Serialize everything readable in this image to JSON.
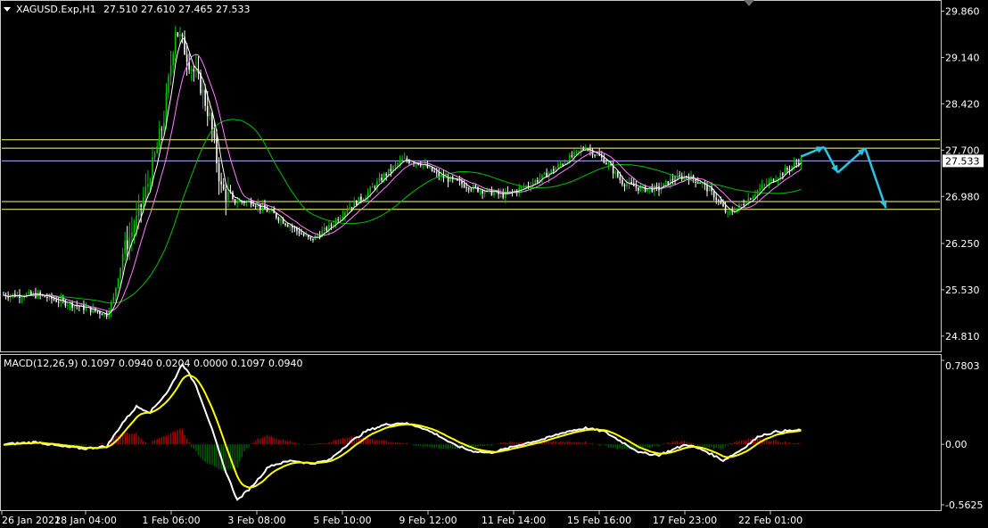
{
  "header": {
    "symbol_label": "XAGUSD.Exp,H1",
    "ohlc": "27.510 27.610 27.465 27.533"
  },
  "macd": {
    "label": "MACD(12,26,9) 0.1097 0.0940 0.0204 0.0000 0.1097 0.0940",
    "ylim": [
      -0.5625,
      0.7803
    ],
    "ticks": [
      "0.7803",
      "0.00",
      "-0.5625"
    ]
  },
  "price": {
    "current": "27.533",
    "ylim": [
      24.6,
      29.95
    ],
    "ticks": [
      "29.860",
      "29.140",
      "28.420",
      "27.700",
      "26.980",
      "26.250",
      "25.530",
      "24.810"
    ],
    "hlines_yellow": [
      27.86,
      27.73,
      26.9,
      26.78
    ],
    "hline_current": 27.533
  },
  "colors": {
    "background": "#000000",
    "border": "#c8c8c8",
    "up_candle": "#00c000",
    "down_candle": "#ffffff",
    "sma_fast": "#ffffff",
    "sma_mid": "#ff80ff",
    "sma_slow": "#00c000",
    "hline": "#ffff80",
    "current_line": "#b0b0ff",
    "macd_line": "#ffffff",
    "signal_line": "#ffff00",
    "hist_pos": "#b00000",
    "hist_neg": "#006000",
    "arrow": "#29c5e6"
  },
  "chart_data": {
    "type": "candlestick",
    "x_tick_labels": [
      "26 Jan 2021",
      "28 Jan 04:00",
      "1 Feb 06:00",
      "3 Feb 08:00",
      "5 Feb 10:00",
      "9 Feb 12:00",
      "11 Feb 14:00",
      "15 Feb 16:00",
      "17 Feb 23:00",
      "22 Feb 01:00"
    ],
    "price_path": [
      [
        0,
        25.45
      ],
      [
        15,
        25.45
      ],
      [
        25,
        25.35
      ],
      [
        35,
        25.25
      ],
      [
        45,
        25.15
      ],
      [
        48,
        25.4
      ],
      [
        52,
        26.1
      ],
      [
        58,
        26.6
      ],
      [
        64,
        27.3
      ],
      [
        70,
        28.2
      ],
      [
        75,
        29.6
      ],
      [
        78,
        29.35
      ],
      [
        82,
        29.0
      ],
      [
        86,
        28.7
      ],
      [
        90,
        28.2
      ],
      [
        95,
        27.1
      ],
      [
        100,
        26.9
      ],
      [
        108,
        26.9
      ],
      [
        118,
        26.7
      ],
      [
        126,
        26.5
      ],
      [
        134,
        26.3
      ],
      [
        142,
        26.5
      ],
      [
        150,
        26.8
      ],
      [
        158,
        27.0
      ],
      [
        166,
        27.3
      ],
      [
        174,
        27.55
      ],
      [
        182,
        27.5
      ],
      [
        190,
        27.3
      ],
      [
        198,
        27.2
      ],
      [
        206,
        27.1
      ],
      [
        212,
        27.05
      ],
      [
        218,
        27.0
      ],
      [
        226,
        27.1
      ],
      [
        236,
        27.3
      ],
      [
        246,
        27.55
      ],
      [
        254,
        27.75
      ],
      [
        262,
        27.55
      ],
      [
        270,
        27.2
      ],
      [
        278,
        27.1
      ],
      [
        286,
        27.1
      ],
      [
        292,
        27.25
      ],
      [
        298,
        27.3
      ],
      [
        304,
        27.2
      ],
      [
        310,
        27.0
      ],
      [
        316,
        26.7
      ],
      [
        322,
        26.85
      ],
      [
        330,
        27.1
      ],
      [
        338,
        27.3
      ],
      [
        344,
        27.45
      ],
      [
        348,
        27.55
      ]
    ],
    "macd_path": [
      [
        0,
        0.0
      ],
      [
        15,
        0.02
      ],
      [
        25,
        -0.02
      ],
      [
        35,
        -0.04
      ],
      [
        45,
        -0.02
      ],
      [
        52,
        0.2
      ],
      [
        58,
        0.35
      ],
      [
        64,
        0.3
      ],
      [
        72,
        0.5
      ],
      [
        78,
        0.75
      ],
      [
        84,
        0.55
      ],
      [
        90,
        0.2
      ],
      [
        96,
        -0.2
      ],
      [
        102,
        -0.52
      ],
      [
        108,
        -0.4
      ],
      [
        116,
        -0.2
      ],
      [
        126,
        -0.15
      ],
      [
        134,
        -0.18
      ],
      [
        142,
        -0.15
      ],
      [
        150,
        0.0
      ],
      [
        158,
        0.12
      ],
      [
        166,
        0.18
      ],
      [
        174,
        0.2
      ],
      [
        182,
        0.16
      ],
      [
        190,
        0.08
      ],
      [
        196,
        0.0
      ],
      [
        204,
        -0.06
      ],
      [
        212,
        -0.08
      ],
      [
        218,
        -0.05
      ],
      [
        226,
        0.0
      ],
      [
        236,
        0.05
      ],
      [
        246,
        0.12
      ],
      [
        254,
        0.15
      ],
      [
        262,
        0.12
      ],
      [
        270,
        0.02
      ],
      [
        278,
        -0.08
      ],
      [
        286,
        -0.1
      ],
      [
        292,
        -0.05
      ],
      [
        298,
        0.0
      ],
      [
        306,
        -0.06
      ],
      [
        314,
        -0.15
      ],
      [
        322,
        -0.05
      ],
      [
        330,
        0.08
      ],
      [
        338,
        0.12
      ],
      [
        348,
        0.13
      ]
    ],
    "forecast_arrows": [
      [
        [
          348,
          27.6
        ],
        [
          358,
          27.75
        ]
      ],
      [
        [
          358,
          27.75
        ],
        [
          364,
          27.35
        ]
      ],
      [
        [
          364,
          27.35
        ],
        [
          376,
          27.73
        ]
      ],
      [
        [
          376,
          27.73
        ],
        [
          385,
          26.8
        ]
      ]
    ]
  }
}
